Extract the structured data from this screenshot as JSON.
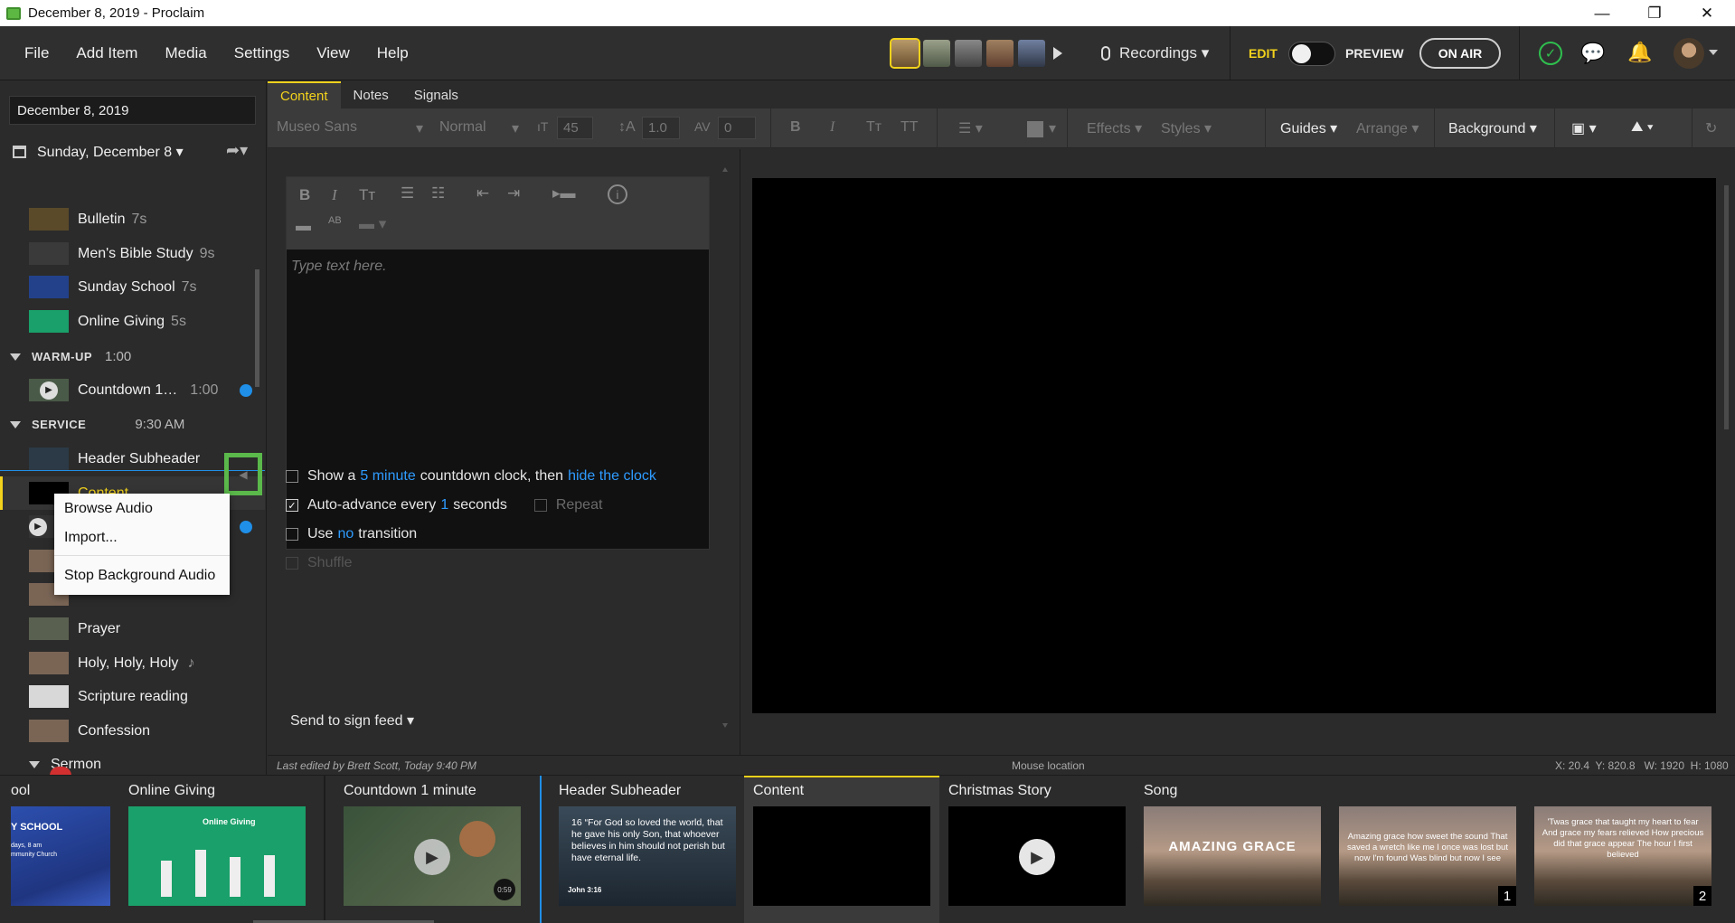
{
  "window": {
    "title": "December 8, 2019 - Proclaim",
    "minimize": "—",
    "maximize": "❐",
    "close": "✕"
  },
  "menu": [
    "File",
    "Add Item",
    "Media",
    "Settings",
    "View",
    "Help"
  ],
  "header": {
    "recordings": "Recordings ▾",
    "edit": "EDIT",
    "preview": "PREVIEW",
    "on_air": "ON AIR"
  },
  "sidebar": {
    "date_value": "December 8, 2019",
    "service_date": "Sunday, December 8 ▾",
    "items": [
      {
        "name": "Bulletin",
        "dur": "7s",
        "color": "#5a4a2a"
      },
      {
        "name": "Men's Bible Study",
        "dur": "9s",
        "color": "#3a3a3a"
      },
      {
        "name": "Sunday School",
        "dur": "7s",
        "color": "#23418a"
      },
      {
        "name": "Online Giving",
        "dur": "5s",
        "color": "#1aa06a"
      }
    ],
    "warmup": {
      "label": "WARM-UP",
      "time": "1:00",
      "item_name": "Countdown 1…",
      "item_dur": "1:00"
    },
    "service": {
      "label": "SERVICE",
      "time": "9:30 AM"
    },
    "service_items": [
      {
        "name": "Header Subheader",
        "color": "#2b3a46"
      },
      {
        "name": "Content",
        "color": "#000000"
      }
    ],
    "later_items": [
      {
        "name": "Prayer",
        "color": "#5a6050"
      },
      {
        "name": "Holy, Holy, Holy",
        "note": "♪",
        "color": "#7a6555"
      },
      {
        "name": "Scripture reading",
        "color": "#d8d8d8"
      },
      {
        "name": "Confession",
        "color": "#7a6555"
      }
    ],
    "sermon": "Sermon"
  },
  "context_menu": [
    "Browse Audio",
    "Import...",
    "Stop Background Audio"
  ],
  "tabs": [
    "Content",
    "Notes",
    "Signals"
  ],
  "toolbar": {
    "font": "Museo Sans",
    "style": "Normal",
    "size": "45",
    "line": "1.0",
    "spacing": "0",
    "effects": "Effects ▾",
    "styles": "Styles ▾",
    "guides": "Guides ▾",
    "arrange": "Arrange ▾",
    "background": "Background ▾"
  },
  "editor": {
    "placeholder": "Type text here.",
    "countdown_pre": "Show a",
    "countdown_link": "5 minute",
    "countdown_mid": "countdown clock, then",
    "countdown_link2": "hide the clock",
    "auto_pre": "Auto-advance every",
    "auto_link": "1",
    "auto_post": "seconds",
    "repeat": "Repeat",
    "use_pre": "Use",
    "use_link": "no",
    "use_post": "transition",
    "shuffle": "Shuffle",
    "send_sign": "Send to sign feed ▾"
  },
  "status": {
    "last_edited": "Last edited by Brett Scott, Today 9:40 PM",
    "mouse": "Mouse location",
    "coords": "X: 20.4  Y: 820.8   W: 1920  H: 1080"
  },
  "filmstrip": [
    {
      "title": "ool",
      "line1": "Y SCHOOL",
      "line2": "days, 8 am",
      "line3": "mmunity Church"
    },
    {
      "title": "Online Giving",
      "inner": "Online Giving"
    },
    {
      "title": "Countdown 1 minute",
      "time": "0:59"
    },
    {
      "title": "Header Subheader",
      "verse": "16 “For God so loved the world, that he gave his only Son, that whoever believes in him should not perish but have eternal life.",
      "ref": "John 3:16"
    },
    {
      "title": "Content"
    },
    {
      "title": "Christmas Story"
    },
    {
      "title": "Song",
      "inner": "AMAZING GRACE"
    },
    {
      "title": "",
      "lyric": "Amazing grace how sweet the sound That saved a wretch like me I once was lost but now I'm found Was blind but now I see",
      "num": "1"
    },
    {
      "title": "",
      "lyric": "'Twas grace that taught my heart to fear And grace my fears relieved How precious did that grace appear The hour I first believed",
      "num": "2"
    }
  ]
}
